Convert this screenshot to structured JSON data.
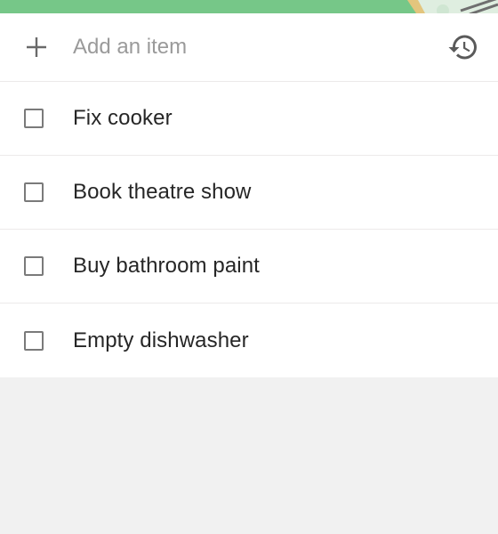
{
  "theme": {
    "banner_color": "#76c788",
    "accent_icon_color": "#5a5a5a"
  },
  "add_item": {
    "placeholder": "Add an item",
    "value": "",
    "leading_icon": "plus-icon",
    "trailing_icon": "history-icon"
  },
  "tasks": [
    {
      "label": "Fix cooker",
      "checked": false
    },
    {
      "label": "Book theatre show",
      "checked": false
    },
    {
      "label": "Buy bathroom paint",
      "checked": false
    },
    {
      "label": "Empty dishwasher",
      "checked": false
    }
  ]
}
